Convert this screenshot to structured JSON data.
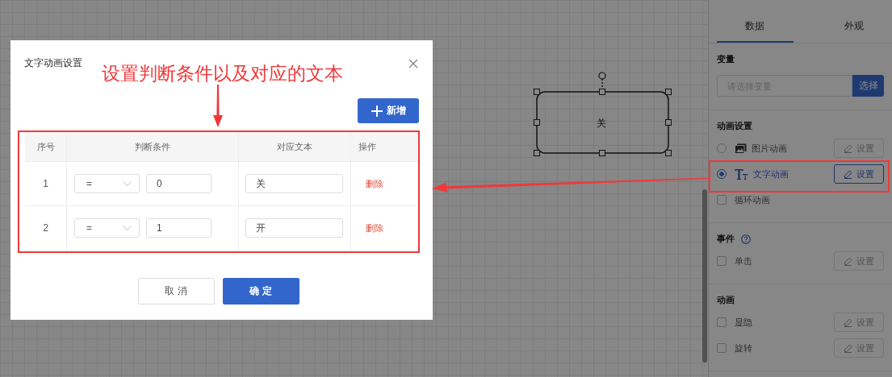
{
  "canvas": {
    "shape": {
      "text": "关"
    }
  },
  "panel": {
    "tabs": [
      {
        "label": "数据",
        "selected": true
      },
      {
        "label": "外观",
        "selected": false
      }
    ],
    "variable": {
      "label": "变量",
      "placeholder": "请选择变量",
      "button": "选择"
    },
    "sections": [
      {
        "title": "动画设置",
        "help": false,
        "items": [
          {
            "kind": "picture",
            "label": "图片动画",
            "selected": false,
            "button": "设置",
            "disabled": true
          },
          {
            "kind": "text",
            "label": "文字动画",
            "selected": true,
            "button": "设置",
            "disabled": false
          },
          {
            "kind": "checkbox",
            "label": "循环动画",
            "checked": false
          }
        ]
      },
      {
        "title": "事件",
        "help": true,
        "items": [
          {
            "kind": "checkbox",
            "label": "单击",
            "checked": false,
            "button": "设置",
            "disabled": true
          }
        ]
      },
      {
        "title": "动画",
        "help": false,
        "items": [
          {
            "kind": "checkbox",
            "label": "显隐",
            "checked": false,
            "button": "设置",
            "disabled": true
          },
          {
            "kind": "checkbox",
            "label": "旋转",
            "checked": false,
            "button": "设置",
            "disabled": true
          }
        ]
      }
    ]
  },
  "dialog": {
    "title": "文字动画设置",
    "add_button": "新增",
    "table": {
      "columns": [
        "序号",
        "判断条件",
        "对应文本",
        "操作"
      ],
      "rows": [
        {
          "index": "1",
          "operator": "=",
          "value": "0",
          "text": "关",
          "action": "删除"
        },
        {
          "index": "2",
          "operator": "=",
          "value": "1",
          "text": "开",
          "action": "删除"
        }
      ]
    },
    "buttons": [
      {
        "label": "取 消",
        "kind": "secondary"
      },
      {
        "label": "确 定",
        "kind": "primary"
      }
    ]
  },
  "annotation": {
    "callout": "设置判断条件以及对应的文本"
  }
}
